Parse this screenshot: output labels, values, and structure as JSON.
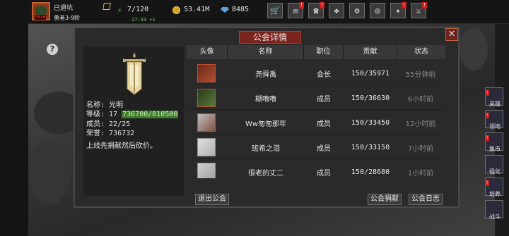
{
  "player": {
    "status": "已退坑",
    "rank": "勇者3-9阶",
    "level_tag": "5536"
  },
  "resources": {
    "stamina": "7/120",
    "timer": "27:33 +1",
    "coins": "53.41M",
    "gems": "8485"
  },
  "top_buttons": [
    {
      "name": "shop-button",
      "icon": "🛒",
      "badge": ""
    },
    {
      "name": "mail-button",
      "icon": "✉",
      "badge": "!"
    },
    {
      "name": "chat-button",
      "icon": "☎",
      "badge": "!"
    },
    {
      "name": "gift-button",
      "icon": "❖",
      "badge": ""
    },
    {
      "name": "settings-button",
      "icon": "⚙",
      "badge": ""
    },
    {
      "name": "wheel-button",
      "icon": "◎",
      "badge": ""
    },
    {
      "name": "event-button",
      "icon": "✦",
      "badge": "!"
    },
    {
      "name": "battle-button",
      "icon": "⚔",
      "badge": "!"
    }
  ],
  "dialog": {
    "title": "公会详情",
    "close": "✕"
  },
  "guild": {
    "name_line": "名称: 光明",
    "level_label": "等级: 17 ",
    "level_exp": "736700/810500",
    "members_line": "成员: 22/25",
    "honor_line": "荣誉: 736732",
    "notice": "上线先捐献然后砍价。"
  },
  "table": {
    "headers": [
      "头像",
      "名称",
      "职位",
      "贡献",
      "状态"
    ],
    "rows": [
      {
        "name": "尧舜禹",
        "position": "会长",
        "contribution": "150/35971",
        "status": "55分钟前"
      },
      {
        "name": "糊噜噜",
        "position": "成员",
        "contribution": "150/36630",
        "status": "6小时前"
      },
      {
        "name": "Ww匆匆那年",
        "position": "成员",
        "contribution": "150/33450",
        "status": "12小时前"
      },
      {
        "name": "班希之泪",
        "position": "成员",
        "contribution": "150/33150",
        "status": "7小时前"
      },
      {
        "name": "很老的丈二",
        "position": "成员",
        "contribution": "150/28680",
        "status": "1小时前"
      }
    ]
  },
  "buttons": {
    "leave": "退出公会",
    "donate": "公会捐献",
    "log": "公会日志"
  },
  "side_nav": [
    {
      "label": "英雄",
      "badge": "!"
    },
    {
      "label": "领地",
      "badge": "!"
    },
    {
      "label": "集市",
      "badge": "!"
    },
    {
      "label": "强化",
      "badge": ""
    },
    {
      "label": "培养",
      "badge": "!"
    },
    {
      "label": "战斗",
      "badge": ""
    }
  ],
  "help": "?"
}
